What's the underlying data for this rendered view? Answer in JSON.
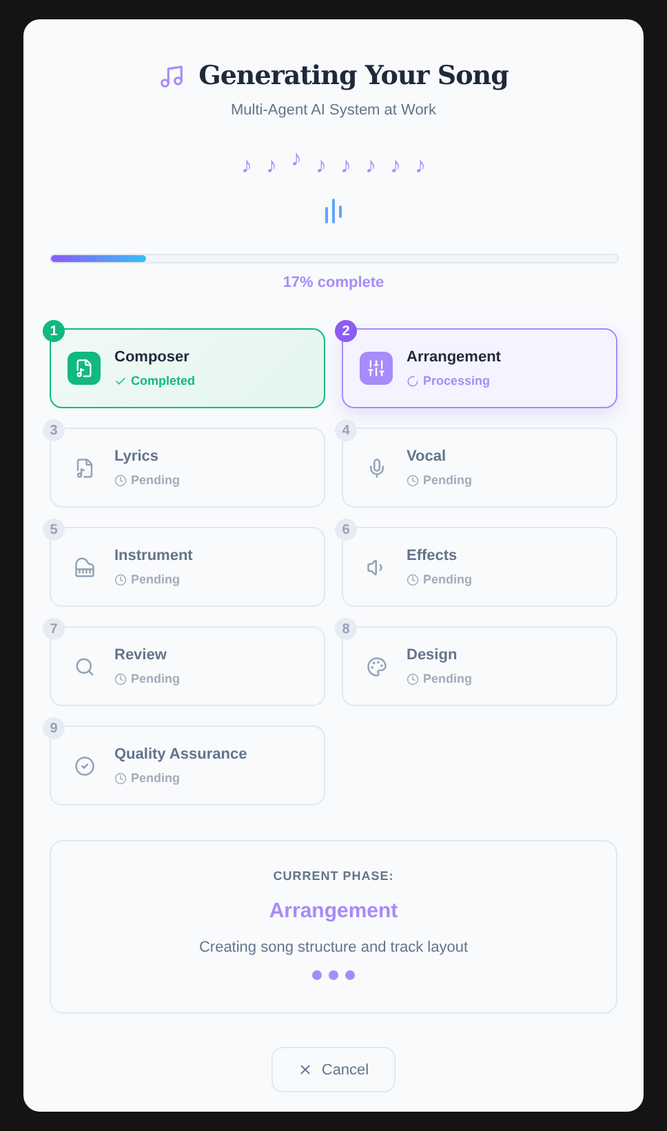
{
  "header": {
    "title": "Generating Your Song",
    "subtitle": "Multi-Agent AI System at Work"
  },
  "notes": [
    "♪",
    "♪",
    "♪",
    "♪",
    "♪",
    "♪",
    "♪",
    "♪"
  ],
  "progress": {
    "level": 0.17,
    "label": "17% complete"
  },
  "agents": [
    {
      "number": "1",
      "name": "Composer",
      "status": "Completed",
      "kind": "completed"
    },
    {
      "number": "2",
      "name": "Arrangement",
      "status": "Processing",
      "kind": "processing"
    },
    {
      "number": "3",
      "name": "Lyrics",
      "status": "Pending",
      "kind": "pending"
    },
    {
      "number": "4",
      "name": "Vocal",
      "status": "Pending",
      "kind": "pending"
    },
    {
      "number": "5",
      "name": "Instrument",
      "status": "Pending",
      "kind": "pending"
    },
    {
      "number": "6",
      "name": "Effects",
      "status": "Pending",
      "kind": "pending"
    },
    {
      "number": "7",
      "name": "Review",
      "status": "Pending",
      "kind": "pending"
    },
    {
      "number": "8",
      "name": "Design",
      "status": "Pending",
      "kind": "pending"
    },
    {
      "number": "9",
      "name": "Quality Assurance",
      "status": "Pending",
      "kind": "pending"
    }
  ],
  "phase": {
    "label": "CURRENT PHASE:",
    "name": "Arrangement",
    "description": "Creating song structure and track layout"
  },
  "cancel": "Cancel"
}
